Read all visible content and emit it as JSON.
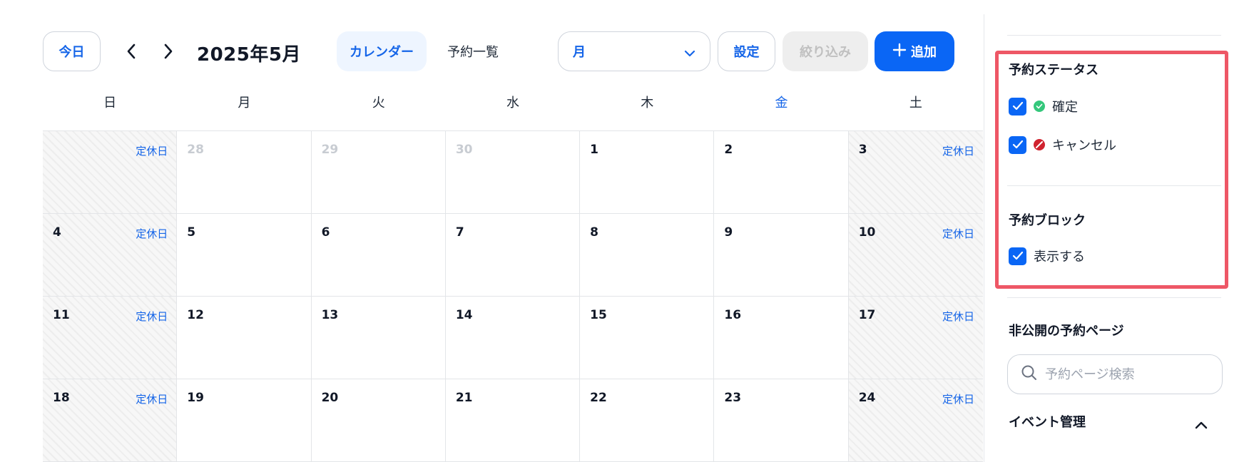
{
  "toolbar": {
    "today_label": "今日",
    "month_title": "2025年5月",
    "tab_calendar": "カレンダー",
    "tab_list": "予約一覧",
    "view_select_value": "月",
    "settings_label": "設定",
    "filter_label": "絞り込み",
    "add_label": "追加"
  },
  "calendar": {
    "weekdays": [
      "日",
      "月",
      "火",
      "水",
      "木",
      "金",
      "土"
    ],
    "holiday_label": "定休日",
    "weeks": [
      [
        {
          "day": "",
          "holiday": true,
          "other": false
        },
        {
          "day": "28",
          "holiday": false,
          "other": true
        },
        {
          "day": "29",
          "holiday": false,
          "other": true
        },
        {
          "day": "30",
          "holiday": false,
          "other": true
        },
        {
          "day": "1",
          "holiday": false,
          "other": false
        },
        {
          "day": "2",
          "holiday": false,
          "other": false
        },
        {
          "day": "3",
          "holiday": true,
          "other": false
        }
      ],
      [
        {
          "day": "4",
          "holiday": true,
          "other": false
        },
        {
          "day": "5",
          "holiday": false,
          "other": false
        },
        {
          "day": "6",
          "holiday": false,
          "other": false
        },
        {
          "day": "7",
          "holiday": false,
          "other": false
        },
        {
          "day": "8",
          "holiday": false,
          "other": false
        },
        {
          "day": "9",
          "holiday": false,
          "other": false
        },
        {
          "day": "10",
          "holiday": true,
          "other": false
        }
      ],
      [
        {
          "day": "11",
          "holiday": true,
          "other": false
        },
        {
          "day": "12",
          "holiday": false,
          "other": false
        },
        {
          "day": "13",
          "holiday": false,
          "other": false
        },
        {
          "day": "14",
          "holiday": false,
          "other": false
        },
        {
          "day": "15",
          "holiday": false,
          "other": false
        },
        {
          "day": "16",
          "holiday": false,
          "other": false
        },
        {
          "day": "17",
          "holiday": true,
          "other": false
        }
      ],
      [
        {
          "day": "18",
          "holiday": true,
          "other": false
        },
        {
          "day": "19",
          "holiday": false,
          "other": false
        },
        {
          "day": "20",
          "holiday": false,
          "other": false
        },
        {
          "day": "21",
          "holiday": false,
          "other": false
        },
        {
          "day": "22",
          "holiday": false,
          "other": false
        },
        {
          "day": "23",
          "holiday": false,
          "other": false
        },
        {
          "day": "24",
          "holiday": true,
          "other": false
        }
      ]
    ]
  },
  "sidebar": {
    "status_section_title": "予約ステータス",
    "status_confirmed_label": "確定",
    "status_cancel_label": "キャンセル",
    "block_section_title": "予約ブロック",
    "block_show_label": "表示する",
    "private_pages_title": "非公開の予約ページ",
    "search_placeholder": "予約ページ検索",
    "event_mgmt_title": "イベント管理"
  },
  "colors": {
    "accent": "#0a66f5",
    "highlight_border": "#ee5766",
    "confirmed_green": "#34c77b",
    "cancel_red": "#d0232f"
  }
}
